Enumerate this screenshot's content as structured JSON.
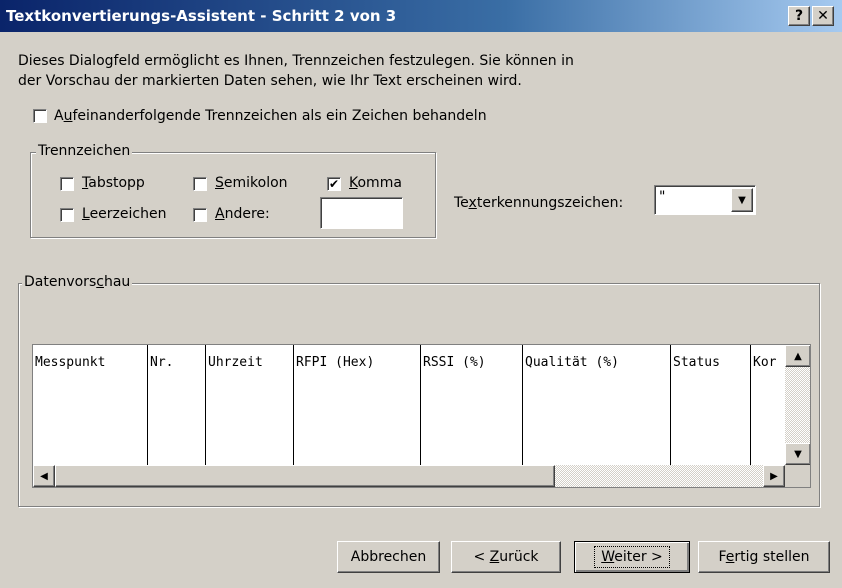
{
  "window": {
    "title": "Textkonvertierungs-Assistent - Schritt 2 von 3",
    "help_button": "?",
    "close_button": "✕"
  },
  "description": {
    "line1": "Dieses Dialogfeld ermöglicht es Ihnen, Trennzeichen festzulegen. Sie können in",
    "line2": "der Vorschau der markierten Daten sehen, wie Ihr Text erscheinen wird."
  },
  "consecutive_delimiters": {
    "label_pre": "A",
    "label_accel": "u",
    "label_post": "feinanderfolgende Trennzeichen als ein Zeichen behandeln",
    "checked": false
  },
  "delimiters": {
    "group_label": "Trennzeichen",
    "tab": {
      "accel": "T",
      "rest": "abstopp",
      "checked": false
    },
    "semicolon": {
      "accel": "S",
      "rest": "emikolon",
      "checked": false
    },
    "comma": {
      "accel": "K",
      "rest": "omma",
      "checked": true,
      "mark": "✔"
    },
    "space": {
      "accel": "L",
      "rest": "eerzeichen",
      "checked": false
    },
    "other": {
      "accel": "A",
      "rest": "ndere:",
      "checked": false,
      "value": ""
    }
  },
  "text_qualifier": {
    "label_pre": "Te",
    "label_accel": "x",
    "label_post": "terkennungszeichen:",
    "value": "\""
  },
  "preview": {
    "group_label_pre": "Datenvors",
    "group_label_accel": "c",
    "group_label_post": "hau",
    "columns": [
      "Messpunkt",
      "Nr.",
      "Uhrzeit",
      "RFPI (Hex)",
      "RSSI (%)",
      "Qualität (%)",
      "Status",
      "Kor"
    ]
  },
  "scroll": {
    "up": "▲",
    "down": "▼",
    "left": "◀",
    "right": "▶",
    "dropdown": "▼"
  },
  "buttons": {
    "cancel": "Abbrechen",
    "back_pre": "< ",
    "back_accel": "Z",
    "back_post": "urück",
    "next_accel": "W",
    "next_post": "eiter >",
    "finish_pre": "F",
    "finish_accel": "e",
    "finish_post": "rtig stellen"
  }
}
